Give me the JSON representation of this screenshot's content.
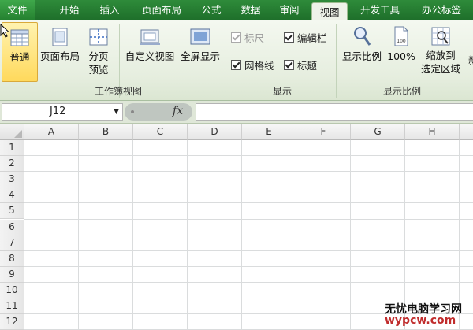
{
  "tabs": [
    {
      "label": "文件",
      "type": "file"
    },
    {
      "label": "开始"
    },
    {
      "label": "插入"
    },
    {
      "label": "页面布局"
    },
    {
      "label": "公式"
    },
    {
      "label": "数据"
    },
    {
      "label": "审阅"
    },
    {
      "label": "视图",
      "active": true
    },
    {
      "label": "开发工具"
    },
    {
      "label": "办公标签"
    }
  ],
  "ribbon": {
    "workbook_views": {
      "group_label": "工作簿视图",
      "normal": "普通",
      "page_layout": "页面布局",
      "page_break_line1": "分页",
      "page_break_line2": "预览",
      "custom_view": "自定义视图",
      "full_screen": "全屏显示"
    },
    "show": {
      "group_label": "显示",
      "ruler": "标尺",
      "formula_bar": "编辑栏",
      "gridlines": "网格线",
      "headings": "标题"
    },
    "zoom": {
      "group_label": "显示比例",
      "zoom": "显示比例",
      "zoom_100": "100%",
      "zoom_sel_line1": "缩放到",
      "zoom_sel_line2": "选定区域",
      "cut_label": "新"
    }
  },
  "formula_bar": {
    "name_box": "J12",
    "fx": "fx",
    "formula_value": ""
  },
  "grid": {
    "columns": [
      "A",
      "B",
      "C",
      "D",
      "E",
      "F",
      "G",
      "H"
    ],
    "rows": [
      "1",
      "2",
      "3",
      "4",
      "5",
      "6",
      "7",
      "8",
      "9",
      "10",
      "11",
      "12"
    ]
  },
  "watermark": {
    "line1": "无忧电脑学习网",
    "line2": "wypcw.com"
  },
  "colors": {
    "tab_green": "#1e6e2a",
    "selected_button": "#ffd95c"
  }
}
